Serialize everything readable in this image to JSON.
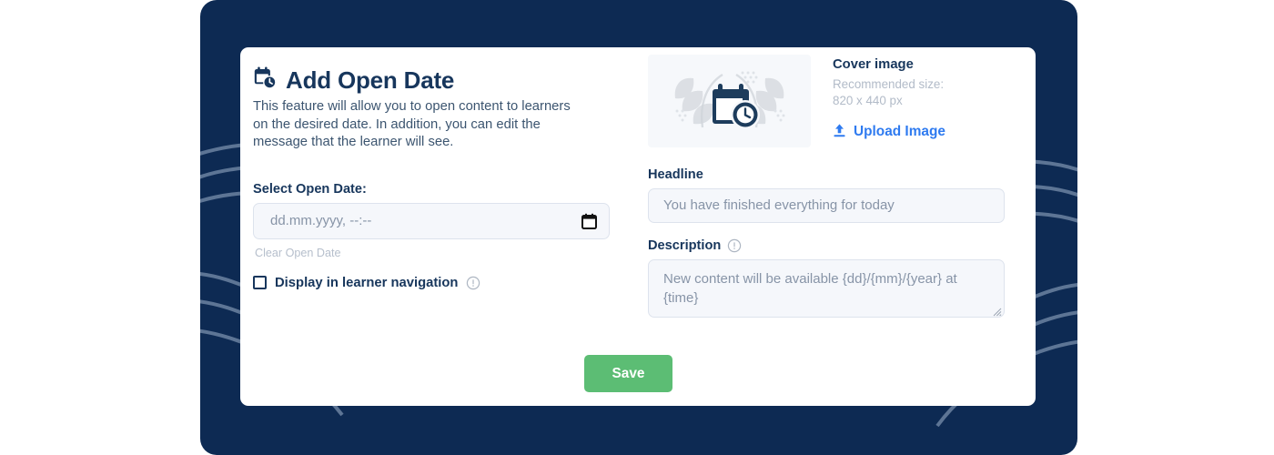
{
  "panel": {
    "background_color": "#0d2a53",
    "decoration_line_color": "#8fa3be"
  },
  "header": {
    "icon": "calendar-clock-icon",
    "title": "Add Open Date",
    "description": "This feature will allow you to open content to learners on the desired date. In addition, you can edit the message that the learner will see."
  },
  "open_date": {
    "label": "Select Open Date:",
    "placeholder": "dd.mm.yyyy, --:--",
    "value": "",
    "calendar_icon": "calendar-icon",
    "clear_label": "Clear Open Date"
  },
  "display_nav": {
    "label": "Display in learner navigation",
    "checked": false,
    "info_icon": "info-circle-icon"
  },
  "cover_image": {
    "thumb_icon": "calendar-clock-illustration",
    "title": "Cover image",
    "recommended_label": "Recommended size:",
    "recommended_value": "820 x 440 px",
    "upload_label": "Upload Image",
    "upload_icon": "upload-icon",
    "link_color": "#2f7bf0"
  },
  "headline": {
    "label": "Headline",
    "placeholder": "You have finished everything for today",
    "value": ""
  },
  "description": {
    "label": "Description",
    "info_icon": "info-circle-icon",
    "placeholder": "New content will be available {dd}/{mm}/{year} at {time}",
    "value": ""
  },
  "footer": {
    "save_label": "Save",
    "save_color": "#5cbd74"
  }
}
